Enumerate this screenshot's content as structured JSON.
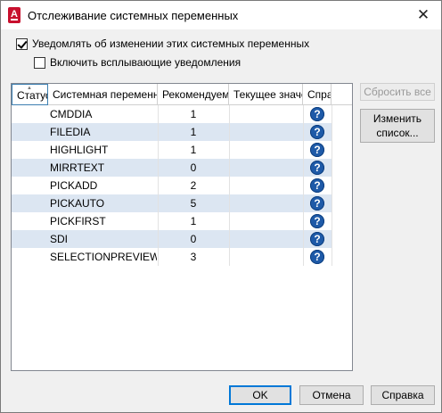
{
  "window": {
    "title": "Отслеживание системных переменных",
    "close_glyph": "✕"
  },
  "options": {
    "notify_label": "Уведомлять об изменении этих системных переменных",
    "notify_checked": true,
    "popup_label": "Включить всплывающие уведомления",
    "popup_checked": false
  },
  "table": {
    "columns": [
      "Статус",
      "Системная переменная",
      "Рекомендуемое",
      "Текущее значение",
      "Справка"
    ],
    "rows": [
      {
        "name": "CMDDIA",
        "recommended": "1",
        "current": "",
        "help": "?"
      },
      {
        "name": "FILEDIA",
        "recommended": "1",
        "current": "",
        "help": "?"
      },
      {
        "name": "HIGHLIGHT",
        "recommended": "1",
        "current": "",
        "help": "?"
      },
      {
        "name": "MIRRTEXT",
        "recommended": "0",
        "current": "",
        "help": "?"
      },
      {
        "name": "PICKADD",
        "recommended": "2",
        "current": "",
        "help": "?"
      },
      {
        "name": "PICKAUTO",
        "recommended": "5",
        "current": "",
        "help": "?"
      },
      {
        "name": "PICKFIRST",
        "recommended": "1",
        "current": "",
        "help": "?"
      },
      {
        "name": "SDI",
        "recommended": "0",
        "current": "",
        "help": "?"
      },
      {
        "name": "SELECTIONPREVIEW",
        "recommended": "3",
        "current": "",
        "help": "?"
      }
    ]
  },
  "buttons": {
    "reset_all": "Сбросить все",
    "edit_list_line1": "Изменить",
    "edit_list_line2": "список...",
    "ok": "OK",
    "cancel": "Отмена",
    "help": "Справка"
  },
  "colors": {
    "row_alt": "#dce6f2",
    "help_icon": "#1e5aa8",
    "brand_icon": "#c8102e"
  }
}
